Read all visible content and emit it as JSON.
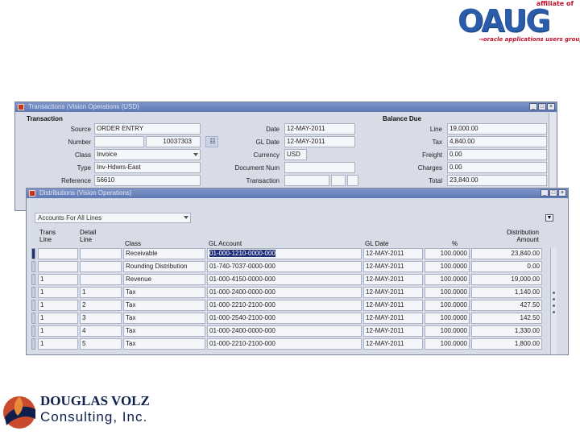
{
  "logos": {
    "oaug": {
      "affiliate": "affiliate of",
      "word": "OAUG",
      "tagline": "oracle applications users group"
    },
    "douglas_volz": {
      "name": "DOUGLAS VOLZ",
      "sub": "Consulting, Inc."
    }
  },
  "transaction_window": {
    "title": "Transactions (Vision Operations (USD)",
    "section": "Transaction",
    "labels": {
      "source": "Source",
      "number": "Number",
      "class": "Class",
      "type": "Type",
      "reference": "Reference",
      "date": "Date",
      "gl_date": "GL Date",
      "currency": "Currency",
      "document_num": "Document Num",
      "transaction": "Transaction"
    },
    "values": {
      "source": "ORDER ENTRY",
      "number": "10037303",
      "class": "Invoice",
      "type": "Inv-Hdwrs-East",
      "reference": "56610",
      "date": "12-MAY-2011",
      "gl_date": "12-MAY-2011",
      "currency": "USD"
    },
    "balance_due": {
      "title": "Balance Due",
      "labels": {
        "line": "Line",
        "tax": "Tax",
        "freight": "Freight",
        "charges": "Charges",
        "total": "Total"
      },
      "values": {
        "line": "19,000.00",
        "tax": "4,840.00",
        "freight": "0.00",
        "charges": "0.00",
        "total": "23,840.00"
      }
    },
    "window_buttons": [
      "_",
      "□",
      "×"
    ]
  },
  "distributions_window": {
    "title": "Distributions (Vision Operations)",
    "filter_dropdown": "Accounts For All Lines",
    "columns": {
      "trans_line": [
        "Trans",
        "Line"
      ],
      "detail_line": [
        "Detail",
        "Line"
      ],
      "class": "Class",
      "gl_account": "GL Account",
      "gl_date": "GL Date",
      "percent": "%",
      "amount": [
        "Distribution",
        "Amount"
      ]
    },
    "rows": [
      {
        "trans_line": "",
        "detail_line": "",
        "class": "Receivable",
        "gl_account": "01-000-1210-0000-000",
        "gl_date": "12-MAY-2011",
        "percent": "100.0000",
        "amount": "23,840.00"
      },
      {
        "trans_line": "",
        "detail_line": "",
        "class": "Rounding Distribution",
        "gl_account": "01-740-7037-0000-000",
        "gl_date": "12-MAY-2011",
        "percent": "100.0000",
        "amount": "0.00"
      },
      {
        "trans_line": "1",
        "detail_line": "",
        "class": "Revenue",
        "gl_account": "01-000-4150-0000-000",
        "gl_date": "12-MAY-2011",
        "percent": "100.0000",
        "amount": "19,000.00"
      },
      {
        "trans_line": "1",
        "detail_line": "1",
        "class": "Tax",
        "gl_account": "01-000-2400-0000-000",
        "gl_date": "12-MAY-2011",
        "percent": "100.0000",
        "amount": "1,140.00"
      },
      {
        "trans_line": "1",
        "detail_line": "2",
        "class": "Tax",
        "gl_account": "01-000-2210-2100-000",
        "gl_date": "12-MAY-2011",
        "percent": "100.0000",
        "amount": "427.50"
      },
      {
        "trans_line": "1",
        "detail_line": "3",
        "class": "Tax",
        "gl_account": "01-000-2540-2100-000",
        "gl_date": "12-MAY-2011",
        "percent": "100.0000",
        "amount": "142.50"
      },
      {
        "trans_line": "1",
        "detail_line": "4",
        "class": "Tax",
        "gl_account": "01-000-2400-0000-000",
        "gl_date": "12-MAY-2011",
        "percent": "100.0000",
        "amount": "1,330.00"
      },
      {
        "trans_line": "1",
        "detail_line": "5",
        "class": "Tax",
        "gl_account": "01-000-2210-2100-000",
        "gl_date": "12-MAY-2011",
        "percent": "100.0000",
        "amount": "1,800.00"
      }
    ],
    "window_buttons": [
      "_",
      "□",
      "×"
    ]
  },
  "colors": {
    "title_bar": "#5e79b6",
    "window_bg": "#d7dce6",
    "selected_cell": "#1f2f7a",
    "oaug_blue": "#2a5caa",
    "oaug_red": "#c0102b",
    "volz_navy": "#0d1f4a"
  }
}
